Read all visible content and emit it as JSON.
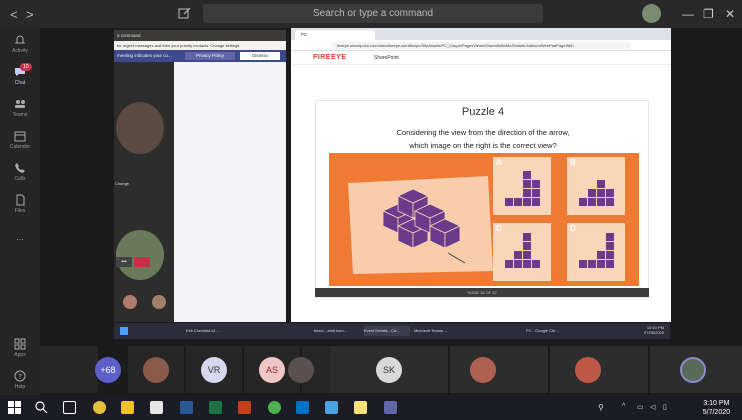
{
  "titlebar": {
    "search_placeholder": "Search or type a command",
    "back": "<",
    "forward": ">",
    "minimize": "—",
    "maximize": "❐",
    "close": "✕"
  },
  "rail": {
    "items": [
      {
        "label": "Activity",
        "icon": "bell-icon"
      },
      {
        "label": "Chat",
        "icon": "chat-icon",
        "badge": "10",
        "active": true
      },
      {
        "label": "Teams",
        "icon": "teams-icon"
      },
      {
        "label": "Calendar",
        "icon": "calendar-icon"
      },
      {
        "label": "Calls",
        "icon": "phone-icon"
      },
      {
        "label": "Files",
        "icon": "file-icon"
      },
      {
        "label": "...",
        "icon": "more-icon"
      }
    ],
    "bottom": [
      {
        "label": "Apps",
        "icon": "apps-icon"
      },
      {
        "label": "Help",
        "icon": "help-icon"
      }
    ]
  },
  "chat_window": {
    "title": "a command",
    "notice": "for urgent messages and then your priority contacts.  Change settings.",
    "banner_text": "meeting indicates your co...",
    "privacy_button": "Privacy Policy",
    "dismiss_button": "Dismiss",
    "name_fragment": "Change",
    "reactions": "•••"
  },
  "browser": {
    "tab_title": "PC",
    "url": "fireeye.sharepoint.com/sites/fireeye-wordles/pc/SiteAssets/PC_Caspe/PagesViews/SharedWithMe/Details-Adelum/WebPartPageWith",
    "logo": "FIREEYE",
    "site": "SharePoint"
  },
  "slide": {
    "title": "Puzzle 4",
    "question_line1": "Considering the view from the direction of the arrow,",
    "question_line2": "which image on the right is the correct view?",
    "answers": [
      "A",
      "B",
      "C",
      "D"
    ],
    "footer": "SLIDE 18 OF 22",
    "colors": {
      "background": "#ee7a33",
      "cube": "#6b3a8a",
      "answer_bg": "#fad6b9",
      "bars": "#6b3a8a"
    }
  },
  "inner_taskbar": {
    "items": [
      "Exit Checklist v2 ...",
      "",
      "",
      "",
      "Inbox - amit.kum...",
      "Event Details - Ca...",
      "Microsoft Teams ...",
      "",
      "",
      "",
      "PC - Google Chr..."
    ],
    "time": "10:10 PM",
    "date": "07/05/2020"
  },
  "participants": [
    {
      "type": "count",
      "text": "+68",
      "color": "#5b5fc7"
    },
    {
      "type": "photo"
    },
    {
      "type": "initials",
      "text": "VR",
      "color": "#d8d7f0",
      "fg": "#333"
    },
    {
      "type": "initials",
      "text": "AS",
      "color": "#f0c7c7",
      "fg": "#8a2a2a"
    },
    {
      "type": "photo"
    },
    {
      "type": "initials",
      "text": "SK",
      "color": "#d9d9d9",
      "fg": "#333"
    },
    {
      "type": "photo"
    },
    {
      "type": "photo"
    },
    {
      "type": "photo"
    }
  ],
  "system_tray": {
    "time": "3:10 PM",
    "date": "5/7/2020"
  }
}
